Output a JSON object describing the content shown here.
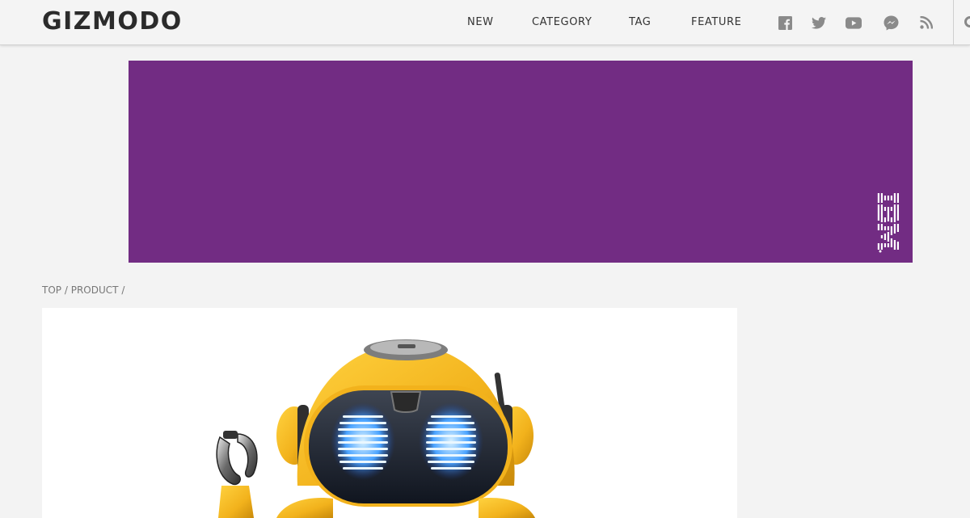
{
  "header": {
    "logo": "GIZMODO",
    "nav": [
      {
        "label": "NEW"
      },
      {
        "label": "CATEGORY"
      },
      {
        "label": "TAG"
      },
      {
        "label": "FEATURE"
      }
    ],
    "social_icons": [
      "facebook-icon",
      "twitter-icon",
      "youtube-icon",
      "messenger-icon",
      "rss-icon"
    ]
  },
  "ad": {
    "brand": "IBM",
    "background_color": "#722c83"
  },
  "breadcrumb": {
    "items": [
      "TOP",
      "PRODUCT"
    ],
    "separator": "/"
  },
  "hero": {
    "image": "yellow-robot-toy"
  },
  "colors": {
    "page_bg": "#f3f3f3",
    "header_bg": "#f4f4f4",
    "text": "#333333",
    "icon": "#8a8a8a",
    "robot_yellow": "#f2b21c"
  }
}
